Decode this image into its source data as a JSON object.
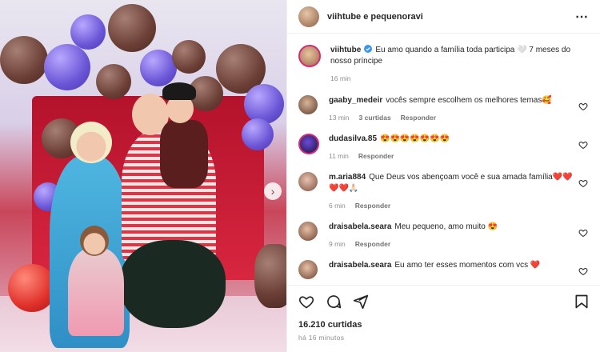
{
  "header": {
    "owner_label": "viihtube e pequenoravi"
  },
  "caption": {
    "user": "viihtube",
    "text": "Eu amo quando a família toda participa 🤍 7 meses do nosso príncipe",
    "time": "16 min"
  },
  "comments": [
    {
      "user": "gaaby_medeir",
      "text": "vocês sempre escolhem os melhores temas🥰",
      "time": "13 min",
      "likes": "3 curtidas",
      "reply": "Responder"
    },
    {
      "user": "dudasilva.85",
      "text": "😍😍😍😍😍😍😍",
      "time": "11 min",
      "reply": "Responder"
    },
    {
      "user": "m.aria884",
      "text": "Que Deus vos abençoam você e sua amada família❤️❤️❤️❤️🙏🏻",
      "time": "6 min",
      "reply": "Responder"
    },
    {
      "user": "draisabela.seara",
      "text": "Meu pequeno, amo muito 😍",
      "time": "9 min",
      "reply": "Responder"
    },
    {
      "user": "draisabela.seara",
      "text": "Eu amo ter esses momentos com vcs ❤️",
      "time": "",
      "reply": ""
    }
  ],
  "likes": "16.210 curtidas",
  "posted": "há 16 minutos",
  "icons": {
    "more": "more-options-icon",
    "heart": "heart-icon",
    "comment": "comment-icon",
    "share": "share-icon",
    "save": "bookmark-icon",
    "verified": "verified-badge-icon",
    "next": "chevron-right-icon"
  },
  "colors": {
    "verified": "#3897f0",
    "story_ring": "#d62976"
  }
}
